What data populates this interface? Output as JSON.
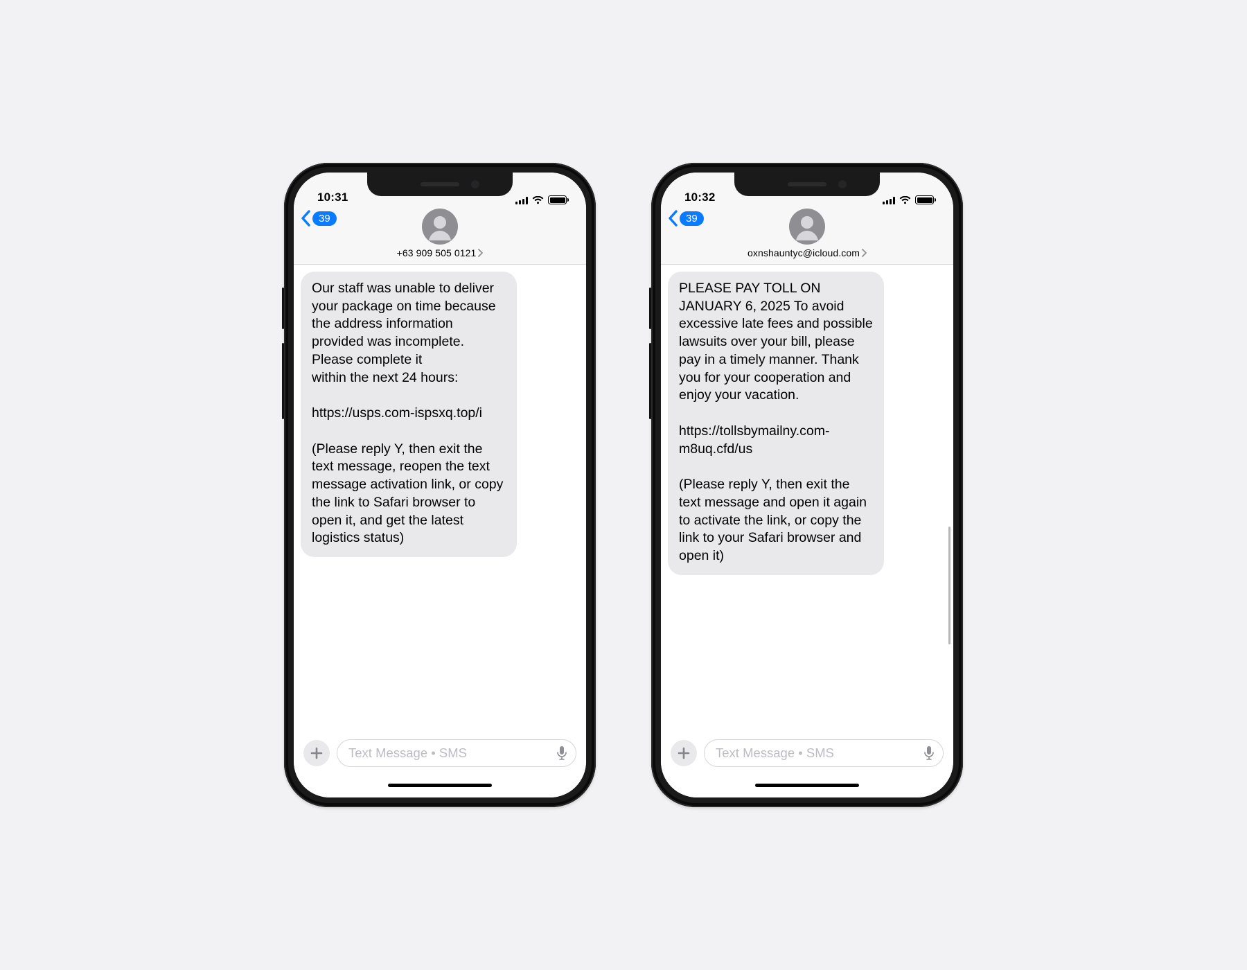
{
  "phones": [
    {
      "status": {
        "time": "10:31"
      },
      "header": {
        "back_badge": "39",
        "sender": "+63 909 505 0121"
      },
      "message": "Our staff was unable to deliver your package on time because the address information provided was incomplete. Please complete it\nwithin the next 24 hours:\n\nhttps://usps.com-ispsxq.top/i\n\n(Please reply Y, then exit the text message, reopen the text message activation link, or copy the link to Safari browser to open it, and get the latest logistics status)",
      "compose": {
        "placeholder": "Text Message • SMS"
      }
    },
    {
      "status": {
        "time": "10:32"
      },
      "header": {
        "back_badge": "39",
        "sender": "oxnshauntyc@icloud.com"
      },
      "message": "PLEASE PAY TOLL ON JANUARY 6, 2025 To avoid excessive late fees and possible lawsuits over your bill, please pay in a timely manner. Thank you for your cooperation and enjoy your vacation.\n\nhttps://tollsbymailny.com-m8uq.cfd/us\n\n(Please reply Y, then exit the text message and open it again to activate the link, or copy the link to your Safari browser and open it)",
      "compose": {
        "placeholder": "Text Message • SMS"
      }
    }
  ]
}
